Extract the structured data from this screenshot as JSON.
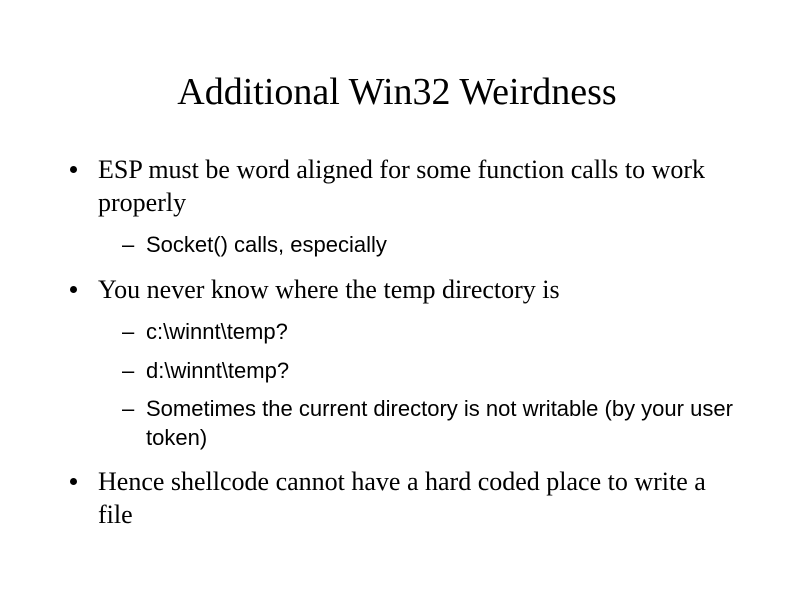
{
  "slide": {
    "title": "Additional Win32 Weirdness",
    "bullets": [
      {
        "text": "ESP must be word aligned for some function calls to work properly",
        "sub": [
          {
            "text": "Socket() calls, especially"
          }
        ]
      },
      {
        "text": "You never know where the temp directory is",
        "sub": [
          {
            "text": "c:\\winnt\\temp?"
          },
          {
            "text": "d:\\winnt\\temp?"
          },
          {
            "text": "Sometimes the current directory is not writable (by your user token)"
          }
        ]
      },
      {
        "text": "Hence shellcode cannot have a hard coded place to write a file",
        "sub": []
      }
    ]
  }
}
